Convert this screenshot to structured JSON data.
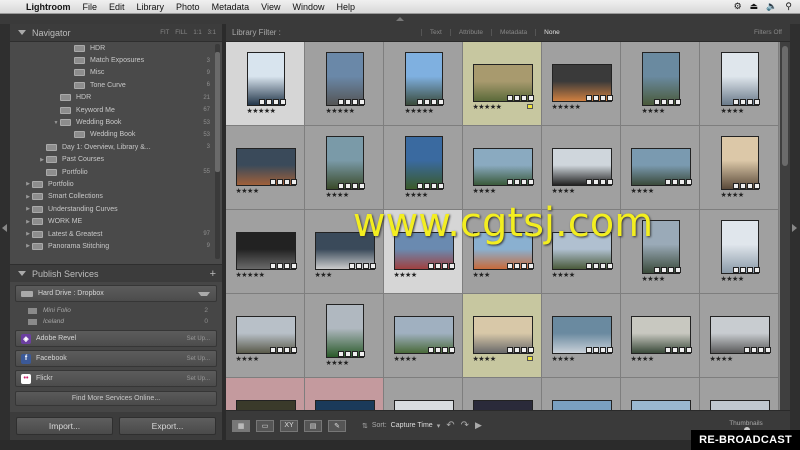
{
  "menubar": {
    "app": "Lightroom",
    "items": [
      "File",
      "Edit",
      "Library",
      "Photo",
      "Metadata",
      "View",
      "Window",
      "Help"
    ]
  },
  "navigator": {
    "title": "Navigator",
    "options": [
      "FIT",
      "FILL",
      "1:1",
      "3:1"
    ]
  },
  "collections": [
    {
      "label": "HDR",
      "count": "",
      "indent": 3,
      "arrow": ""
    },
    {
      "label": "Match Exposures",
      "count": "3",
      "indent": 3,
      "arrow": ""
    },
    {
      "label": "Misc",
      "count": "9",
      "indent": 3,
      "arrow": ""
    },
    {
      "label": "Tone Curve",
      "count": "6",
      "indent": 3,
      "arrow": ""
    },
    {
      "label": "HDR",
      "count": "21",
      "indent": 2,
      "arrow": ""
    },
    {
      "label": "Keyword Me",
      "count": "67",
      "indent": 2,
      "arrow": ""
    },
    {
      "label": "Wedding Book",
      "count": "53",
      "indent": 2,
      "arrow": "▼"
    },
    {
      "label": "Wedding Book",
      "count": "53",
      "indent": 3,
      "arrow": ""
    },
    {
      "label": "Day 1: Overview, Library &...",
      "count": "3",
      "indent": 1,
      "arrow": ""
    },
    {
      "label": "Past Courses",
      "count": "",
      "indent": 1,
      "arrow": "▶"
    },
    {
      "label": "Portfolio",
      "count": "55",
      "indent": 1,
      "arrow": ""
    },
    {
      "label": "Portfolio",
      "count": "",
      "indent": 0,
      "arrow": "▶"
    },
    {
      "label": "Smart Collections",
      "count": "",
      "indent": 0,
      "arrow": "▶"
    },
    {
      "label": "Understanding Curves",
      "count": "",
      "indent": 0,
      "arrow": "▶"
    },
    {
      "label": "WORK ME",
      "count": "",
      "indent": 0,
      "arrow": "▶"
    },
    {
      "label": "Latest & Greatest",
      "count": "97",
      "indent": 0,
      "arrow": "▶"
    },
    {
      "label": "Panorama Stitching",
      "count": "9",
      "indent": 0,
      "arrow": "▶"
    }
  ],
  "publish": {
    "title": "Publish Services",
    "hard_drive": "Hard Drive : Dropbox",
    "subs": [
      {
        "label": "Mini Folio",
        "count": "2"
      },
      {
        "label": "Iceland",
        "count": "0"
      }
    ],
    "services": [
      {
        "label": "Adobe Revel",
        "setup": "Set Up...",
        "color": "#6b3fa0",
        "glyph": "◈",
        "icon": "adobe-revel-icon"
      },
      {
        "label": "Facebook",
        "setup": "Set Up...",
        "color": "#3b5998",
        "glyph": "f",
        "icon": "facebook-icon"
      },
      {
        "label": "Flickr",
        "setup": "Set Up...",
        "color": "#ffffff",
        "glyph": "••",
        "icon": "flickr-icon"
      }
    ],
    "find_more": "Find More Services Online..."
  },
  "buttons": {
    "import": "Import...",
    "export": "Export..."
  },
  "filter": {
    "label": "Library Filter :",
    "options": [
      "Text",
      "Attribute",
      "Metadata",
      "None"
    ],
    "active": "None",
    "filters_off": "Filters Off"
  },
  "grid": {
    "cells": [
      {
        "stars": "★★★★★",
        "bg": "sel",
        "thumb": [
          "#d8e4ee",
          "#23364a"
        ],
        "portrait": true,
        "flag": false
      },
      {
        "stars": "★★★★★",
        "bg": "",
        "thumb": [
          "#6a88a8",
          "#555"
        ],
        "portrait": true,
        "flag": false
      },
      {
        "stars": "★★★★★",
        "bg": "",
        "thumb": [
          "#7fb0e0",
          "#3a4a3a"
        ],
        "portrait": true,
        "flag": false
      },
      {
        "stars": "★★★★★",
        "bg": "yel",
        "thumb": [
          "#a89a6e",
          "#5b6a3a"
        ],
        "portrait": false,
        "flag": true
      },
      {
        "stars": "★★★★★",
        "bg": "",
        "thumb": [
          "#3a3a3a",
          "#d08040"
        ],
        "portrait": false,
        "flag": false
      },
      {
        "stars": "★★★★",
        "bg": "",
        "thumb": [
          "#6a8aa0",
          "#4a5a3a"
        ],
        "portrait": true,
        "flag": false
      },
      {
        "stars": "★★★★",
        "bg": "",
        "thumb": [
          "#dfe6ec",
          "#6a7a8a"
        ],
        "portrait": true,
        "flag": false
      },
      {
        "stars": "★★★★",
        "bg": "",
        "thumb": [
          "#3a4a5a",
          "#a0603a"
        ],
        "portrait": false,
        "flag": false
      },
      {
        "stars": "★★★★",
        "bg": "",
        "thumb": [
          "#7a9aa8",
          "#3a4a2a"
        ],
        "portrait": true,
        "flag": false
      },
      {
        "stars": "★★★★",
        "bg": "",
        "thumb": [
          "#3a6aa0",
          "#3a5a2a"
        ],
        "portrait": true,
        "flag": false
      },
      {
        "stars": "★★★★",
        "bg": "",
        "thumb": [
          "#8aaac0",
          "#3a5a3a"
        ],
        "portrait": false,
        "flag": false
      },
      {
        "stars": "★★★★",
        "bg": "",
        "thumb": [
          "#cfd6dc",
          "#222"
        ],
        "portrait": false,
        "flag": false
      },
      {
        "stars": "★★★★",
        "bg": "",
        "thumb": [
          "#7a9ab0",
          "#3a4a3a"
        ],
        "portrait": false,
        "flag": false
      },
      {
        "stars": "★★★★",
        "bg": "",
        "thumb": [
          "#dcc8a8",
          "#5a4a3a"
        ],
        "portrait": true,
        "flag": false
      },
      {
        "stars": "★★★★★",
        "bg": "",
        "thumb": [
          "#222",
          "#6a6a6a"
        ],
        "portrait": false,
        "flag": false
      },
      {
        "stars": "★★★",
        "bg": "",
        "thumb": [
          "#3a4a5a",
          "#ccc"
        ],
        "portrait": false,
        "flag": false
      },
      {
        "stars": "★★★★",
        "bg": "sel",
        "thumb": [
          "#6a8ab0",
          "#a04040"
        ],
        "portrait": false,
        "flag": false
      },
      {
        "stars": "★★★",
        "bg": "",
        "thumb": [
          "#8ab0d0",
          "#c86a3a"
        ],
        "portrait": false,
        "flag": false
      },
      {
        "stars": "★★★★",
        "bg": "",
        "thumb": [
          "#b0c0d0",
          "#4a5a3a"
        ],
        "portrait": false,
        "flag": false
      },
      {
        "stars": "★★★★",
        "bg": "",
        "thumb": [
          "#9aaab8",
          "#3a4a3a"
        ],
        "portrait": true,
        "flag": false
      },
      {
        "stars": "★★★★",
        "bg": "",
        "thumb": [
          "#e0e6ec",
          "#8a9aa8"
        ],
        "portrait": true,
        "flag": false
      },
      {
        "stars": "★★★★",
        "bg": "",
        "thumb": [
          "#b8c0c8",
          "#5a5a4a"
        ],
        "portrait": false,
        "flag": false
      },
      {
        "stars": "★★★★",
        "bg": "",
        "thumb": [
          "#b0b8c0",
          "#2a5a2a"
        ],
        "portrait": true,
        "flag": false
      },
      {
        "stars": "★★★★",
        "bg": "",
        "thumb": [
          "#a0b0c0",
          "#4a6a3a"
        ],
        "portrait": false,
        "flag": false
      },
      {
        "stars": "★★★★",
        "bg": "yel",
        "thumb": [
          "#d8c8a8",
          "#6a6a6a"
        ],
        "portrait": false,
        "flag": true
      },
      {
        "stars": "★★★★",
        "bg": "",
        "thumb": [
          "#6a8aa0",
          "#c8d0d8"
        ],
        "portrait": false,
        "flag": false
      },
      {
        "stars": "★★★★",
        "bg": "",
        "thumb": [
          "#c8c8c0",
          "#3a4a3a"
        ],
        "portrait": false,
        "flag": false
      },
      {
        "stars": "★★★★",
        "bg": "",
        "thumb": [
          "#c8ccd0",
          "#5a5a5a"
        ],
        "portrait": false,
        "flag": false
      },
      {
        "stars": "",
        "bg": "pink",
        "thumb": [
          "#3a3a2a",
          "#c8a060"
        ],
        "portrait": false,
        "flag": false
      },
      {
        "stars": "",
        "bg": "pink",
        "thumb": [
          "#1a3a5a",
          "#8ab0d0"
        ],
        "portrait": false,
        "flag": false
      },
      {
        "stars": "",
        "bg": "",
        "thumb": [
          "#d8dce0",
          "#6a6a5a"
        ],
        "portrait": false,
        "flag": false
      },
      {
        "stars": "",
        "bg": "",
        "thumb": [
          "#2a2a3a",
          "#c84a3a"
        ],
        "portrait": false,
        "flag": false
      },
      {
        "stars": "",
        "bg": "",
        "thumb": [
          "#7aa0c0",
          "#d0d0d0"
        ],
        "portrait": false,
        "flag": false
      },
      {
        "stars": "",
        "bg": "",
        "thumb": [
          "#9ab8d0",
          "#4a6a3a"
        ],
        "portrait": false,
        "flag": false
      },
      {
        "stars": "",
        "bg": "",
        "thumb": [
          "#c0c8d0",
          "#7a8a5a"
        ],
        "portrait": false,
        "flag": false
      }
    ]
  },
  "toolbar": {
    "sort_label": "Sort:",
    "sort_value": "Capture Time",
    "thumbnails_label": "Thumbnails"
  },
  "watermark": "www.cgtsj.com",
  "rebroadcast": "RE-BROADCAST"
}
